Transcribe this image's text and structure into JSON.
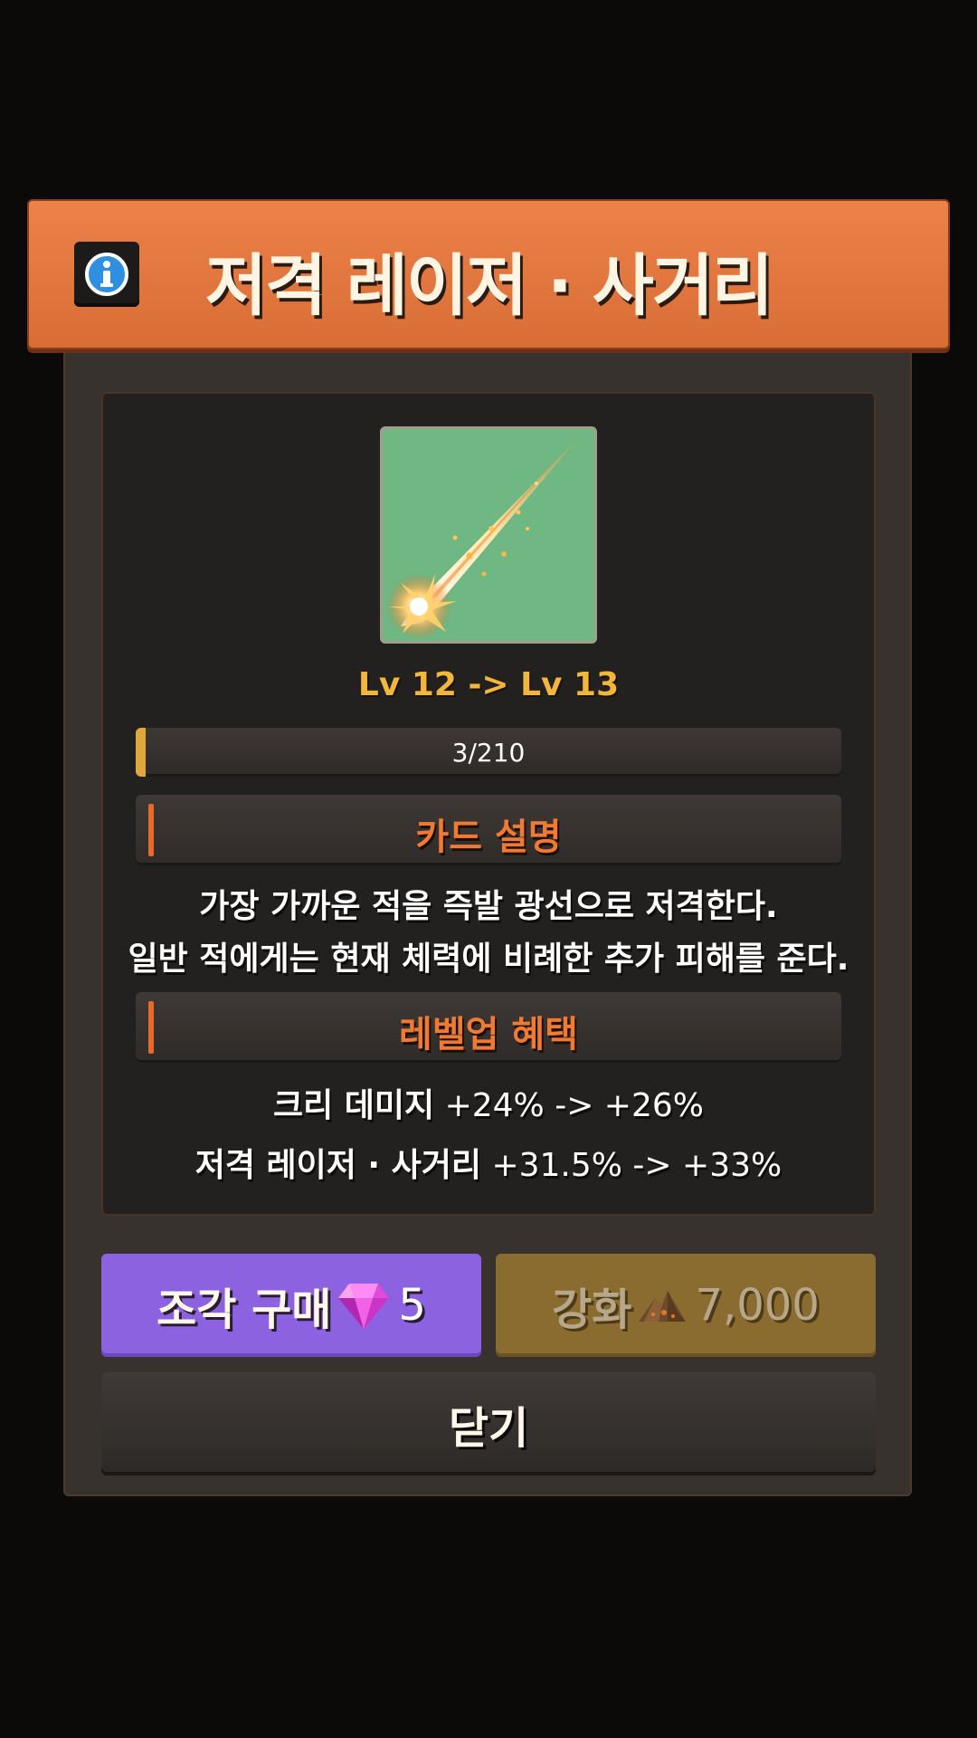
{
  "header": {
    "title": "저격 레이저 · 사거리"
  },
  "card": {
    "level_text": "Lv 12 -> Lv 13",
    "progress": {
      "label": "3/210",
      "current": 3,
      "max": 210
    }
  },
  "sections": {
    "description_title": "카드 설명",
    "description_lines": [
      "가장 가까운 적을 즉발 광선으로 저격한다.",
      "일반 적에게는 현재 체력에 비례한 추가 피해를 준다."
    ],
    "levelup_title": "레벨업 혜택"
  },
  "stats": [
    {
      "name": "크리 데미지",
      "value": " +24% -> +26%"
    },
    {
      "name": "저격 레이저 · 사거리",
      "value": " +31.5% -> +33%"
    }
  ],
  "buttons": {
    "buy": {
      "label": "조각 구매",
      "cost": "5",
      "icon": "gem-icon"
    },
    "upgrade": {
      "label": "강화",
      "cost": "7,000",
      "icon": "ore-pile-icon"
    },
    "close": {
      "label": "닫기"
    }
  },
  "colors": {
    "header": "#e4773f",
    "accent_text": "#f07a32",
    "level_text": "#f2b63a",
    "buy_button": "#8c62e1",
    "upgrade_button": "#8a6c31",
    "card_bg": "#6fb783"
  }
}
